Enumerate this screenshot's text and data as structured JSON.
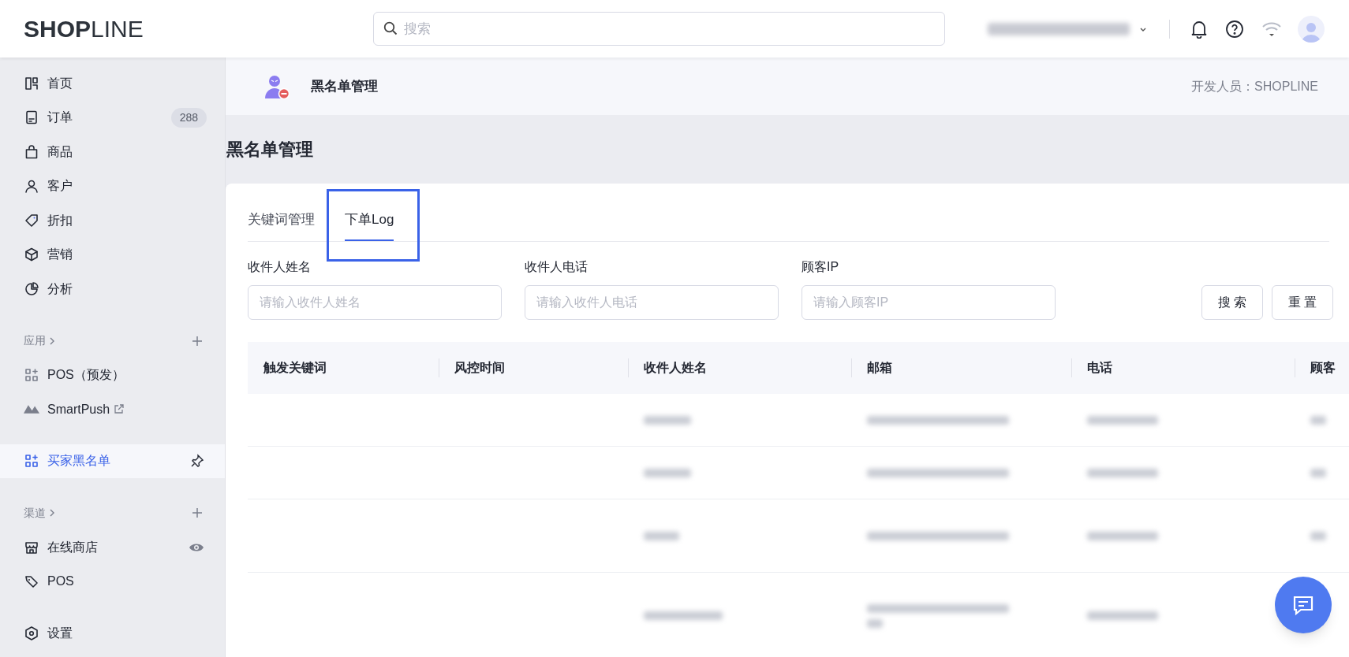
{
  "topbar": {
    "logo": "**SHOP**LINE",
    "search": {
      "placeholder": "搜索"
    }
  },
  "sidebar": {
    "groups": [
      {
        "items": [
          {
            "label": "首页",
            "selected": false
          },
          {
            "label": "订单",
            "badge": "288",
            "selected": false
          },
          {
            "label": "商品",
            "selected": false
          },
          {
            "label": "客户",
            "selected": false
          },
          {
            "label": "折扣",
            "selected": false
          },
          {
            "label": "营销",
            "selected": false
          },
          {
            "label": "分析",
            "selected": false
          }
        ]
      },
      {
        "title": "应用",
        "items": [
          {
            "label": "POS（预发）",
            "selected": false
          },
          {
            "label": "SmartPush",
            "external": true,
            "selected": false
          }
        ]
      },
      {
        "items": [
          {
            "label": "买家黑名单",
            "pinned": true,
            "selected": true
          }
        ]
      },
      {
        "title": "渠道",
        "items": [
          {
            "label": "在线商店",
            "visible": true,
            "selected": false
          },
          {
            "label": "POS",
            "selected": false
          }
        ]
      },
      {
        "items": [
          {
            "label": "设置",
            "selected": false
          }
        ]
      }
    ]
  },
  "app_header": {
    "title": "黑名单管理",
    "developer": "开发人员：SHOPLINE"
  },
  "page_title": "黑名单管理",
  "tabs": [
    {
      "label": "关键词管理",
      "selected": false,
      "highlighted": false
    },
    {
      "label": "下单Log",
      "selected": true,
      "highlighted": true
    }
  ],
  "filters": [
    {
      "label": "收件人姓名",
      "placeholder": "请输入收件人姓名"
    },
    {
      "label": "收件人电话",
      "placeholder": "请输入收件人电话"
    },
    {
      "label": "顾客IP",
      "placeholder": "请输入顾客IP"
    }
  ],
  "buttons": [
    "搜 索",
    "重 置"
  ],
  "table": {
    "columns": [
      "触发关键词",
      "风控时间",
      "收件人姓名",
      "邮箱",
      "电话",
      "顾客"
    ],
    "rows": [
      {
        "kind": "single"
      },
      {
        "kind": "single"
      },
      {
        "kind": "single"
      },
      {
        "kind": "double"
      }
    ]
  }
}
